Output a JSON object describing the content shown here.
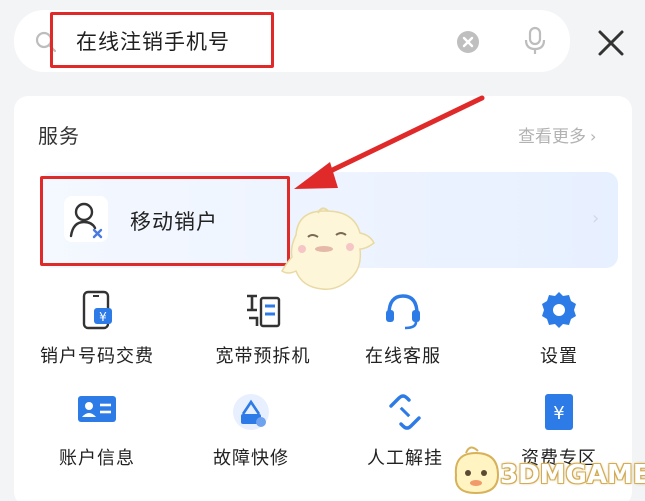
{
  "search": {
    "query": "在线注销手机号"
  },
  "services": {
    "title": "服务",
    "more_label": "查看更多",
    "top_item": {
      "label": "移动销户"
    }
  },
  "grid": {
    "items": [
      {
        "label": "销户号码交费",
        "icon": "phone-payment-icon"
      },
      {
        "label": "宽带预拆机",
        "icon": "broadband-icon"
      },
      {
        "label": "在线客服",
        "icon": "headset-icon"
      },
      {
        "label": "设置",
        "icon": "gear-icon"
      },
      {
        "label": "账户信息",
        "icon": "id-card-icon"
      },
      {
        "label": "故障快修",
        "icon": "repair-icon"
      },
      {
        "label": "人工解挂",
        "icon": "unlink-icon"
      },
      {
        "label": "资费专区",
        "icon": "yuan-doc-icon"
      }
    ]
  },
  "colors": {
    "accent": "#1a73e8",
    "highlight": "#e02a2a"
  },
  "watermark": {
    "text": "3DMGAME"
  }
}
